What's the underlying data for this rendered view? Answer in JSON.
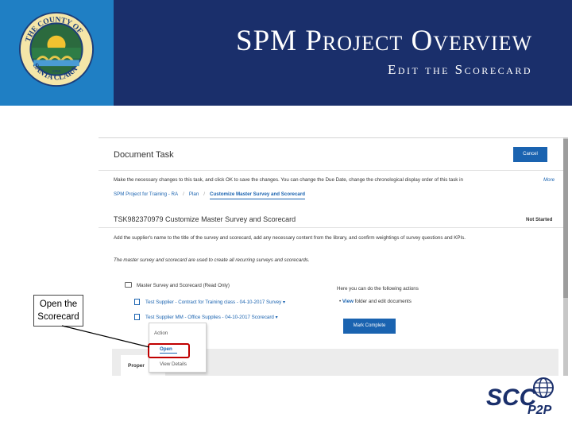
{
  "slide": {
    "title": "SPM Project Overview",
    "subtitle": "Edit the Scorecard",
    "callout": "Open the Scorecard"
  },
  "document_task": {
    "title": "Document Task",
    "cancel_label": "Cancel",
    "instructions": "Make the necessary changes to this task, and click OK to save the changes. You can change the Due Date, change the chronological display order of this task in",
    "more_label": "More",
    "breadcrumbs": [
      "SPM Project for Training - RA",
      "Plan",
      "Customize Master Survey and Scorecard"
    ],
    "task_title": "TSK982370979 Customize Master Survey and Scorecard",
    "status": "Not Started",
    "description": "Add the supplier's name to the title of the survey and scorecard, add any necessary content from the library, and confirm weightings of survey questions and KPIs.",
    "note": "The master survey and scorecard are used to create all recurring surveys and scorecards.",
    "folder": "Master Survey and Scorecard (Read Only)",
    "files": [
      "Test Supplier - Contract for Training class - 04-10-2017 Survey ▾",
      "Test Supplier MM - Office Supplies - 04-10-2017 Scorecard ▾"
    ],
    "actions_heading": "Here you can do the following actions",
    "actions_bullet_link": "View",
    "actions_bullet_text": "folder and edit documents",
    "mark_complete_label": "Mark Complete",
    "panel_tab": "Proper"
  },
  "action_menu": {
    "heading": "Action",
    "open": "Open",
    "view_details": "View Details"
  },
  "colors": {
    "header_navy": "#1a2f6b",
    "logo_blue": "#1f7fc4",
    "link_blue": "#1a63b0",
    "highlight_red": "#c00000"
  },
  "icons": [
    "county-seal-icon",
    "folder-icon",
    "document-icon",
    "scc-p2p-logo"
  ]
}
